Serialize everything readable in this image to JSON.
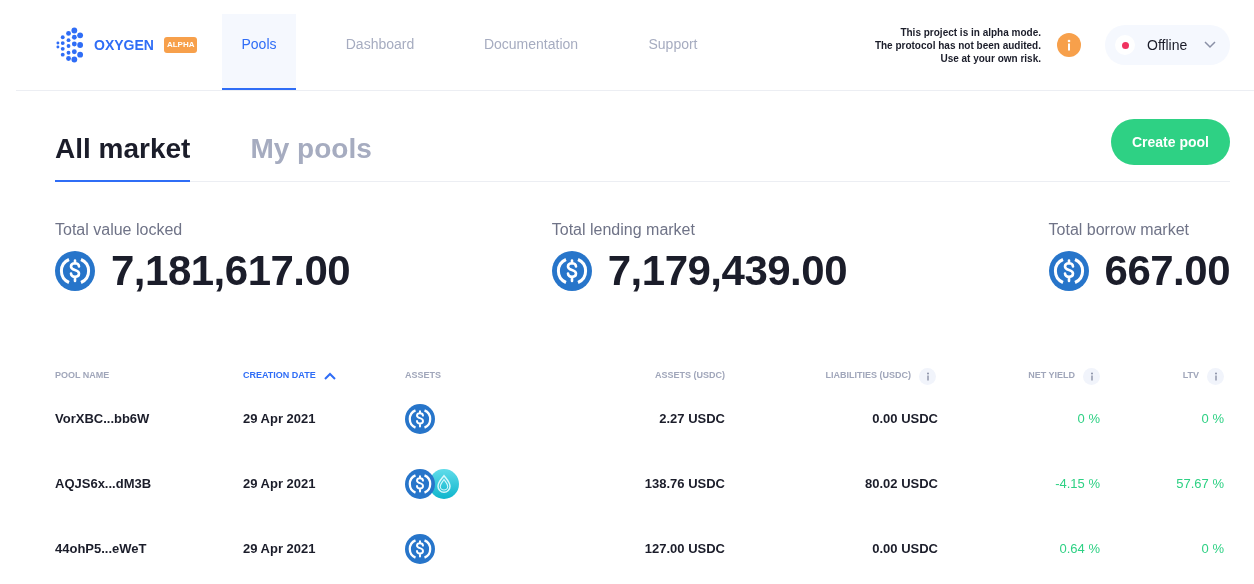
{
  "brand": {
    "name": "OXYGEN",
    "badge": "ALPHA"
  },
  "nav": [
    {
      "label": "Pools",
      "selected": true
    },
    {
      "label": "Dashboard",
      "selected": false
    },
    {
      "label": "Documentation",
      "selected": false
    },
    {
      "label": "Support",
      "selected": false
    }
  ],
  "alpha_notice": [
    "This project is in alpha mode.",
    "The protocol has not been audited.",
    "Use at your own risk."
  ],
  "connection": {
    "label": "Offline",
    "online": false
  },
  "tabs": [
    {
      "label": "All market",
      "selected": true
    },
    {
      "label": "My pools",
      "selected": false
    }
  ],
  "create_button": "Create pool",
  "stats": [
    {
      "label": "Total value locked",
      "value": "7,181,617.00"
    },
    {
      "label": "Total lending market",
      "value": "7,179,439.00"
    },
    {
      "label": "Total borrow market",
      "value": "667.00"
    }
  ],
  "table": {
    "columns": [
      {
        "label": "POOL NAME",
        "sorted": false,
        "info": false
      },
      {
        "label": "CREATION DATE",
        "sorted": true,
        "info": false
      },
      {
        "label": "ASSETS",
        "sorted": false,
        "info": false
      },
      {
        "label": "ASSETS (USDC)",
        "sorted": false,
        "info": false
      },
      {
        "label": "LIABILITIES (USDC)",
        "sorted": false,
        "info": true
      },
      {
        "label": "NET YIELD",
        "sorted": false,
        "info": true
      },
      {
        "label": "LTV",
        "sorted": false,
        "info": true
      }
    ],
    "rows": [
      {
        "name": "VorXBC...bb6W",
        "date": "29 Apr 2021",
        "assets": [
          {
            "kind": "usdc"
          }
        ],
        "assets_usdc": "2.27 USDC",
        "liabilities": "0.00 USDC",
        "net_yield": "0 %",
        "ltv": "0 %"
      },
      {
        "name": "AQJS6x...dM3B",
        "date": "29 Apr 2021",
        "assets": [
          {
            "kind": "usdc"
          },
          {
            "kind": "drop"
          }
        ],
        "assets_usdc": "138.76 USDC",
        "liabilities": "80.02 USDC",
        "net_yield": "-4.15 %",
        "ltv": "57.67 %"
      },
      {
        "name": "44ohP5...eWeT",
        "date": "29 Apr 2021",
        "assets": [
          {
            "kind": "usdc"
          }
        ],
        "assets_usdc": "127.00 USDC",
        "liabilities": "0.00 USDC",
        "net_yield": "0.64 %",
        "ltv": "0 %"
      }
    ]
  }
}
